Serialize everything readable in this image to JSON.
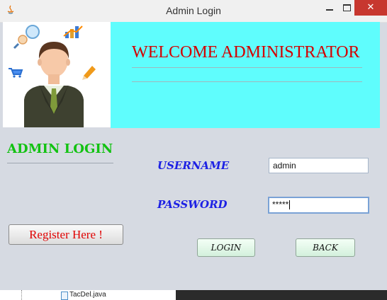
{
  "window": {
    "title": "Admin Login",
    "close_glyph": "✕"
  },
  "banner": {
    "welcome": "WELCOME ADMINISTRATOR"
  },
  "panel": {
    "heading": "ADMIN LOGIN"
  },
  "form": {
    "username_label": "USERNAME",
    "username_value": "admin",
    "password_label": "PASSWORD",
    "password_value": "*****"
  },
  "buttons": {
    "register": "Register Here !",
    "login": "LOGIN",
    "back": "BACK"
  },
  "background": {
    "file_name": "TacDel.java"
  },
  "icons": [
    "java-app-icon",
    "minimize-icon",
    "maximize-icon",
    "close-icon",
    "admin-avatar-icon",
    "search-bubble-icon",
    "bar-chart-icon",
    "cart-icon",
    "pencil-icon"
  ],
  "colors": {
    "banner_bg": "#5ffdfd",
    "welcome_text": "#d40000",
    "heading_green": "#12c212",
    "label_blue": "#1d21e4",
    "close_red": "#c7372f"
  }
}
